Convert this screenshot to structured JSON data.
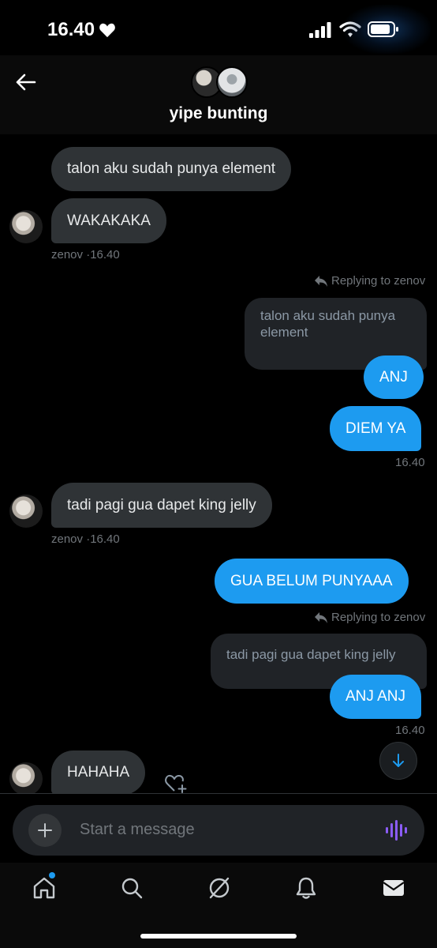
{
  "status_bar": {
    "time": "16.40",
    "heart_icon": "heart-icon",
    "signal_icon": "cellular-signal-icon",
    "wifi_icon": "wifi-icon",
    "battery_icon": "battery-icon"
  },
  "header": {
    "title": "yipe bunting",
    "back_icon": "back-arrow-icon"
  },
  "messages": [
    {
      "text": "talon aku sudah punya element"
    },
    {
      "text": "WAKAKAKA",
      "meta": "zenov ·16.40"
    },
    {
      "reply_label": "Replying to zenov",
      "quote": "talon aku sudah punya element"
    },
    {
      "text": "ANJ"
    },
    {
      "text": "DIEM YA",
      "meta": "16.40"
    },
    {
      "text": "tadi pagi gua dapet king jelly",
      "meta": "zenov ·16.40"
    },
    {
      "text": "GUA BELUM PUNYAAA"
    },
    {
      "reply_label": "Replying to zenov",
      "quote": "tadi pagi gua dapet king jelly"
    },
    {
      "text": "ANJ ANJ",
      "meta": "16.40"
    },
    {
      "text": "HAHAHA"
    }
  ],
  "composer": {
    "placeholder": "Start a message",
    "add_icon": "plus-icon",
    "voice_icon": "voice-waveform-icon"
  },
  "nav": {
    "items": [
      "home-icon",
      "search-icon",
      "grok-icon",
      "bell-icon",
      "mail-icon"
    ]
  },
  "colors": {
    "accent": "#1d9bf0",
    "bubble_in": "#2f3336",
    "background": "#000000",
    "voice": "#8b5cf6"
  }
}
